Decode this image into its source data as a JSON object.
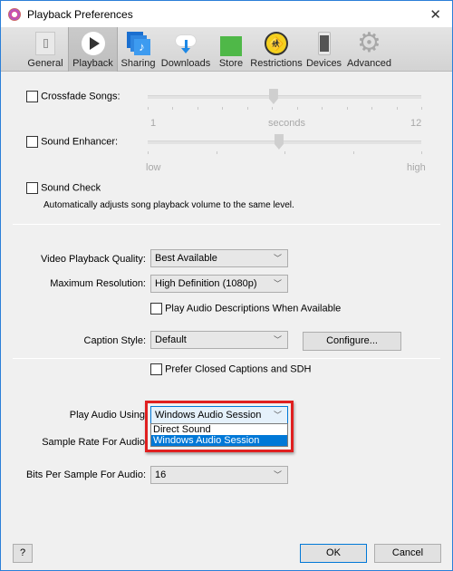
{
  "window": {
    "title": "Playback Preferences",
    "close_label": "✕"
  },
  "tabs": [
    {
      "label": "General",
      "icon": "switch-icon"
    },
    {
      "label": "Playback",
      "icon": "play-icon",
      "active": true
    },
    {
      "label": "Sharing",
      "icon": "music-share-icon"
    },
    {
      "label": "Downloads",
      "icon": "cloud-download-icon"
    },
    {
      "label": "Store",
      "icon": "shopping-bag-icon"
    },
    {
      "label": "Restrictions",
      "icon": "parental-icon"
    },
    {
      "label": "Devices",
      "icon": "phone-icon"
    },
    {
      "label": "Advanced",
      "icon": "gear-icon"
    }
  ],
  "crossfade": {
    "label": "Crossfade Songs:",
    "checked": false,
    "min_label": "1",
    "unit_label": "seconds",
    "max_label": "12",
    "value_fraction": 0.46
  },
  "enhancer": {
    "label": "Sound Enhancer:",
    "checked": false,
    "min_label": "low",
    "max_label": "high",
    "value_fraction": 0.48
  },
  "sound_check": {
    "label": "Sound Check",
    "checked": false,
    "description": "Automatically adjusts song playback volume to the same level."
  },
  "video_quality": {
    "label": "Video Playback Quality:",
    "value": "Best Available"
  },
  "max_resolution": {
    "label": "Maximum Resolution:",
    "value": "High Definition (1080p)"
  },
  "audio_desc": {
    "label": "Play Audio Descriptions When Available",
    "checked": false
  },
  "caption_style": {
    "label": "Caption Style:",
    "value": "Default",
    "configure_label": "Configure..."
  },
  "closed_captions": {
    "label": "Prefer Closed Captions and SDH",
    "checked": false
  },
  "play_audio": {
    "label": "Play Audio Using:",
    "value": "Windows Audio Session",
    "options": [
      "Direct Sound",
      "Windows Audio Session"
    ],
    "selected_index": 1
  },
  "sample_rate": {
    "label": "Sample Rate For Audio:"
  },
  "bits_per_sample": {
    "label": "Bits Per Sample For Audio:",
    "value": "16"
  },
  "footer": {
    "help_label": "?",
    "ok_label": "OK",
    "cancel_label": "Cancel"
  },
  "colors": {
    "highlight": "#0078d7",
    "annotation": "#e02020"
  }
}
